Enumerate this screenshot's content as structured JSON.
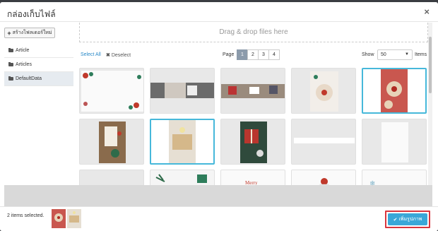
{
  "modal": {
    "title": "กล่องเก็บไฟล์",
    "close_glyph": "×"
  },
  "sidebar": {
    "create_folder_label": "สร้างโฟลเดอร์ใหม่",
    "folders": [
      {
        "label": "Article",
        "active": false
      },
      {
        "label": "Articles",
        "active": false
      },
      {
        "label": "DefaultData",
        "active": true
      }
    ]
  },
  "dropzone": {
    "text": "Drag & drop files here"
  },
  "toolbar": {
    "select_all": "Select All",
    "deselect": "Deselect",
    "page_label": "Page",
    "pages": [
      "1",
      "2",
      "3",
      "4"
    ],
    "current_page": "1",
    "show_label": "Show",
    "show_value": "50",
    "items_label": "Items"
  },
  "grid": {
    "tiles": [
      {
        "name": "christmas-frame-card",
        "selected": false
      },
      {
        "name": "holding-mug-knit",
        "selected": false
      },
      {
        "name": "gifts-table-flatlay",
        "selected": false
      },
      {
        "name": "linzer-cookies-plate",
        "selected": false
      },
      {
        "name": "linzer-cookies-red",
        "selected": true
      },
      {
        "name": "christmas-drink-berries",
        "selected": false
      },
      {
        "name": "cookies-tray-candle",
        "selected": true
      },
      {
        "name": "gift-box-red",
        "selected": false
      },
      {
        "name": "thin-banner",
        "selected": false
      },
      {
        "name": "white-card",
        "selected": false
      },
      {
        "name": "pine-branch-gift",
        "selected": false
      },
      {
        "name": "merry-card",
        "selected": false
      },
      {
        "name": "santa-card",
        "selected": false
      },
      {
        "name": "snowflake-card",
        "selected": false
      }
    ]
  },
  "footer": {
    "selected_text": "2 items selected.",
    "ok_label": "เพิ่มรูปภาพ"
  },
  "colors": {
    "accent": "#3aa7d8",
    "highlight_border": "#d9363e",
    "active_page": "#8c9bab"
  }
}
